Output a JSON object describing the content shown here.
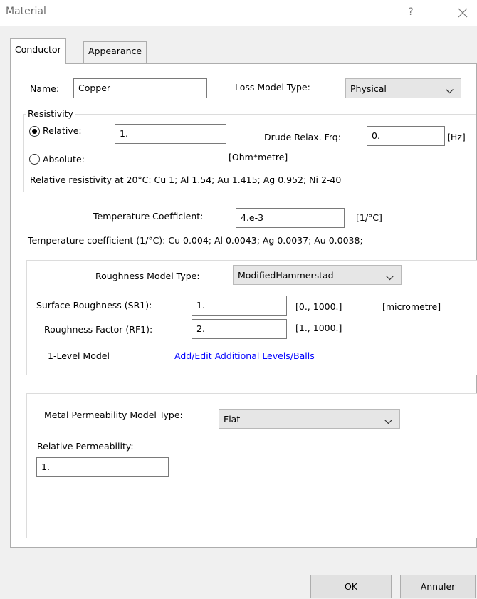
{
  "window": {
    "title": "Material",
    "help_glyph": "?",
    "close_icon": "close-icon"
  },
  "tabs": [
    {
      "label": "Conductor",
      "active": true
    },
    {
      "label": "Appearance",
      "active": false
    }
  ],
  "name_row": {
    "name_label": "Name:",
    "name_value": "Copper",
    "loss_model_label": "Loss Model Type:",
    "loss_model_value": "Physical"
  },
  "resistivity": {
    "group_label": "Resistivity",
    "relative_label": "Relative:",
    "relative_selected": true,
    "relative_value": "1.",
    "drude_label": "Drude Relax. Frq:",
    "drude_value": "0.",
    "drude_unit": "[Hz]",
    "absolute_label": "Absolute:",
    "absolute_unit": "[Ohm*metre]",
    "hint": "Relative resistivity at 20°C: Cu 1; Al 1.54; Au 1.415; Ag 0.952; Ni 2-40"
  },
  "temperature": {
    "label": "Temperature Coefficient:",
    "value": "4.e-3",
    "unit": "[1/°C]",
    "hint": "Temperature coefficient (1/°C): Cu 0.004; Al  0.0043; Ag 0.0037; Au 0.0038;"
  },
  "roughness": {
    "model_label": "Roughness Model Type:",
    "model_value": "ModifiedHammerstad",
    "sr1_label": "Surface Roughness (SR1):",
    "sr1_value": "1.",
    "sr1_range": "[0., 1000.]",
    "sr1_unit": "[micrometre]",
    "rf1_label": "Roughness Factor (RF1):",
    "rf1_value": "2.",
    "rf1_range": "[1., 1000.]",
    "level_label": "1-Level Model",
    "edit_link": "Add/Edit Additional Levels/Balls"
  },
  "permeability": {
    "model_label": "Metal Permeability Model Type:",
    "model_value": "Flat",
    "relative_label": "Relative Permeability:",
    "relative_value": "1."
  },
  "buttons": {
    "ok": "OK",
    "cancel": "Annuler"
  }
}
